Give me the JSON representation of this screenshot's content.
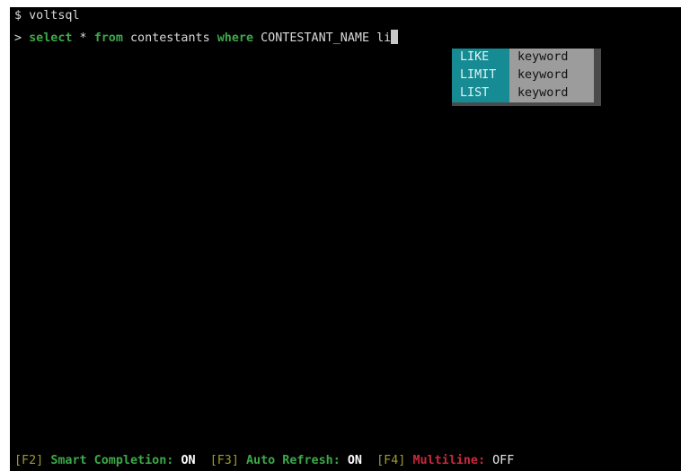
{
  "terminal": {
    "prompt_line": "$ voltsql",
    "query": {
      "prompt": "> ",
      "tokens": [
        {
          "text": "select",
          "type": "keyword"
        },
        {
          "text": " * ",
          "type": "text"
        },
        {
          "text": "from",
          "type": "keyword"
        },
        {
          "text": " contestants ",
          "type": "text"
        },
        {
          "text": "where",
          "type": "keyword"
        },
        {
          "text": " CONTESTANT_NAME li",
          "type": "text"
        }
      ]
    },
    "completions": [
      {
        "name": "LIKE",
        "type": "keyword"
      },
      {
        "name": "LIMIT",
        "type": "keyword"
      },
      {
        "name": "LIST",
        "type": "keyword"
      }
    ]
  },
  "toolbar": {
    "smart_completion": {
      "key": "[F2]",
      "label": "Smart Completion:",
      "value": "ON"
    },
    "auto_refresh": {
      "key": "[F3]",
      "label": "Auto Refresh:",
      "value": "ON"
    },
    "multiline": {
      "key": "[F4]",
      "label": "Multiline:",
      "value": "OFF"
    }
  },
  "colors": {
    "background": "#000000",
    "keyword": "#3da84a",
    "completion_name_bg": "#178b93",
    "completion_type_bg": "#9c9c9c",
    "fkey": "#a09a2e",
    "multiline_label": "#c8283c"
  }
}
